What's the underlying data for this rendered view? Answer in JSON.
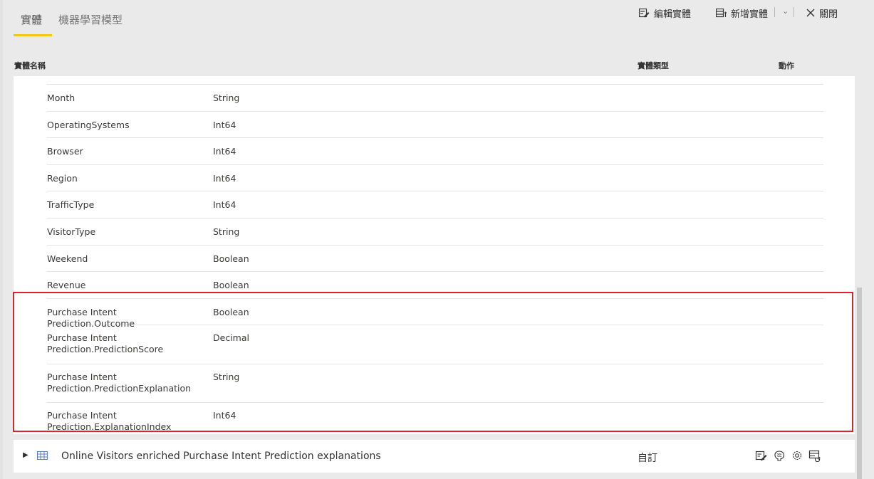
{
  "tabs": [
    {
      "label": "實體",
      "active": true
    },
    {
      "label": "機器學習模型",
      "active": false
    }
  ],
  "toolbar": {
    "edit_entity": "編輯實體",
    "add_entity": "新增實體",
    "close": "關閉"
  },
  "columns": {
    "name": "實體名稱",
    "type": "實體類型",
    "actions": "動作"
  },
  "fields": [
    {
      "name": "Month",
      "type": "String"
    },
    {
      "name": "OperatingSystems",
      "type": "Int64"
    },
    {
      "name": "Browser",
      "type": "Int64"
    },
    {
      "name": "Region",
      "type": "Int64"
    },
    {
      "name": "TrafficType",
      "type": "Int64"
    },
    {
      "name": "VisitorType",
      "type": "String"
    },
    {
      "name": "Weekend",
      "type": "Boolean"
    },
    {
      "name": "Revenue",
      "type": "Boolean"
    },
    {
      "name": "Purchase Intent Prediction.Outcome",
      "type": "Boolean"
    },
    {
      "name": "Purchase Intent Prediction.PredictionScore",
      "type": "Decimal"
    },
    {
      "name": "Purchase Intent Prediction.PredictionExplanation",
      "type": "String"
    },
    {
      "name": "Purchase Intent Prediction.ExplanationIndex",
      "type": "Int64"
    }
  ],
  "entity": {
    "name": "Online Visitors enriched Purchase Intent Prediction explanations",
    "type": "自訂",
    "actions": [
      "edit-icon",
      "brain-icon",
      "settings-icon",
      "refresh-icon"
    ]
  },
  "colors": {
    "accent": "#f2c811",
    "highlight_border": "#d7262f"
  }
}
